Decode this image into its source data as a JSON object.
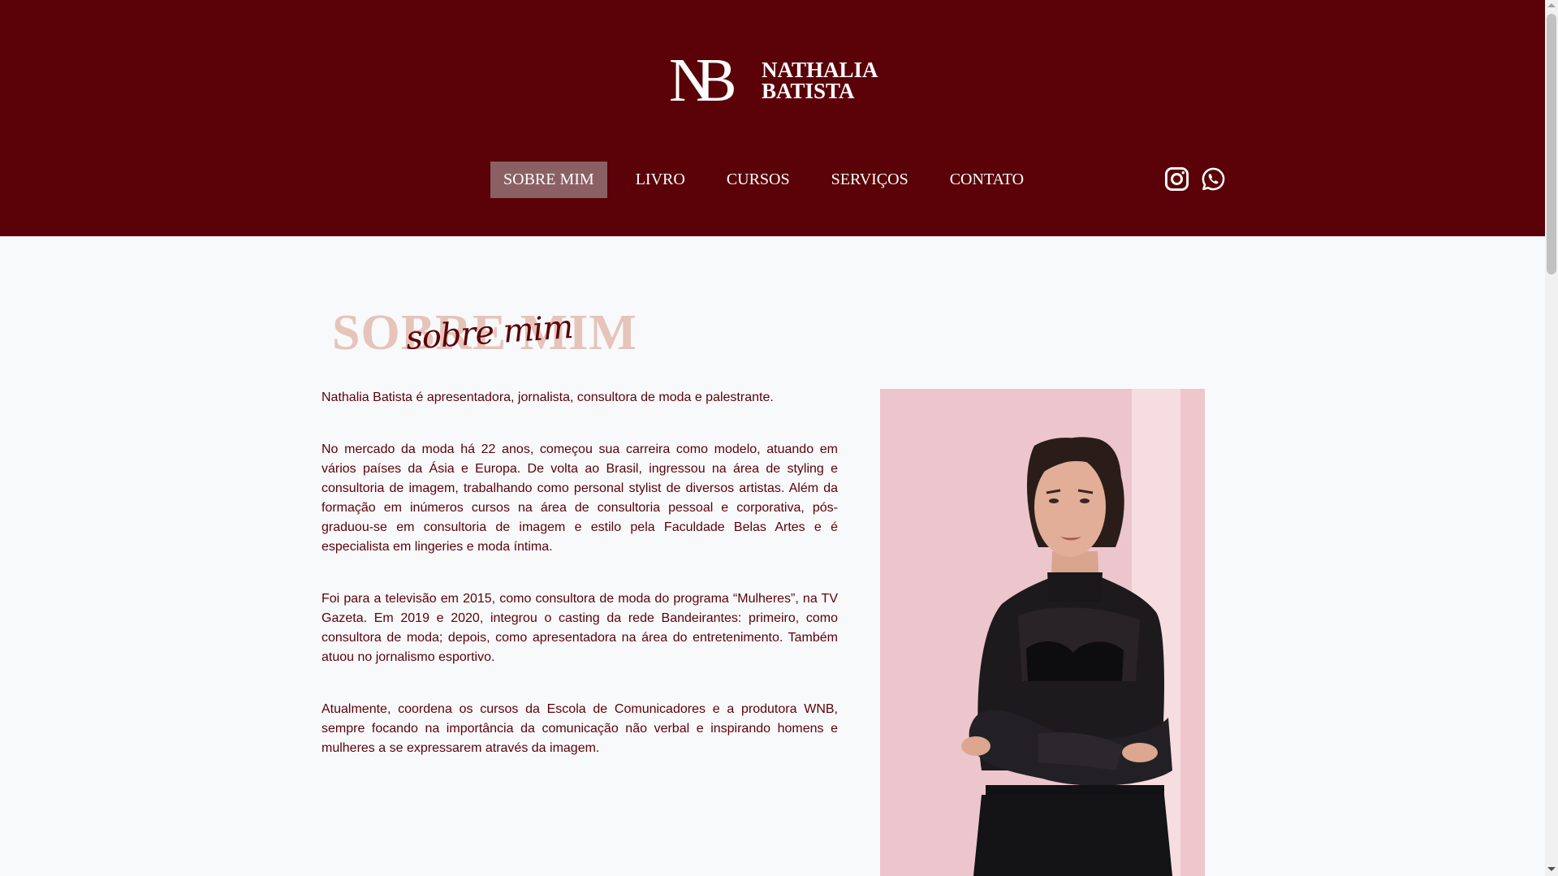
{
  "brand": {
    "monogram_n": "N",
    "monogram_b": "B",
    "name_line1": "NATHALIA",
    "name_line2": "BATISTA",
    "bg_color": "#5a0208"
  },
  "nav": {
    "items": [
      {
        "label": "SOBRE MIM",
        "active": true
      },
      {
        "label": "LIVRO",
        "active": false
      },
      {
        "label": "CURSOS",
        "active": false
      },
      {
        "label": "SERVIÇOS",
        "active": false
      },
      {
        "label": "CONTATO",
        "active": false
      }
    ]
  },
  "social": {
    "icons": [
      "instagram-icon",
      "whatsapp-icon"
    ]
  },
  "section": {
    "title": "SOBRE MIM",
    "script_title": "sobre mim",
    "title_color": "#e6c4b9",
    "paragraphs": [
      "Nathalia Batista é apresentadora, jornalista, consultora de moda e palestrante.",
      "No mercado da moda há 22 anos, começou sua carreira como modelo, atuando em vários países da Ásia e Europa. De volta ao Brasil, ingressou na área de styling e consultoria de imagem, trabalhando como personal stylist de diversos artistas. Além da formação em inúmeros cursos na área de consultoria pessoal e corporativa, pós-graduou-se em consultoria de imagem e estilo pela Faculdade Belas Artes e é especialista em lingeries e moda íntima.",
      "Foi para a televisão em 2015, como consultora de moda do programa “Mulheres”, na TV Gazeta. Em 2019 e 2020, integrou o casting da rede Bandeirantes: primeiro, como consultora de moda; depois, como apresentadora na área do entretenimento. Também atuou no jornalismo esportivo.",
      "Atualmente, coordena os cursos da Escola de Comunicadores e a produtora WNB, sempre focando na importância da comunicação não verbal e inspirando homens e mulheres a se expressarem através da imagem."
    ]
  }
}
